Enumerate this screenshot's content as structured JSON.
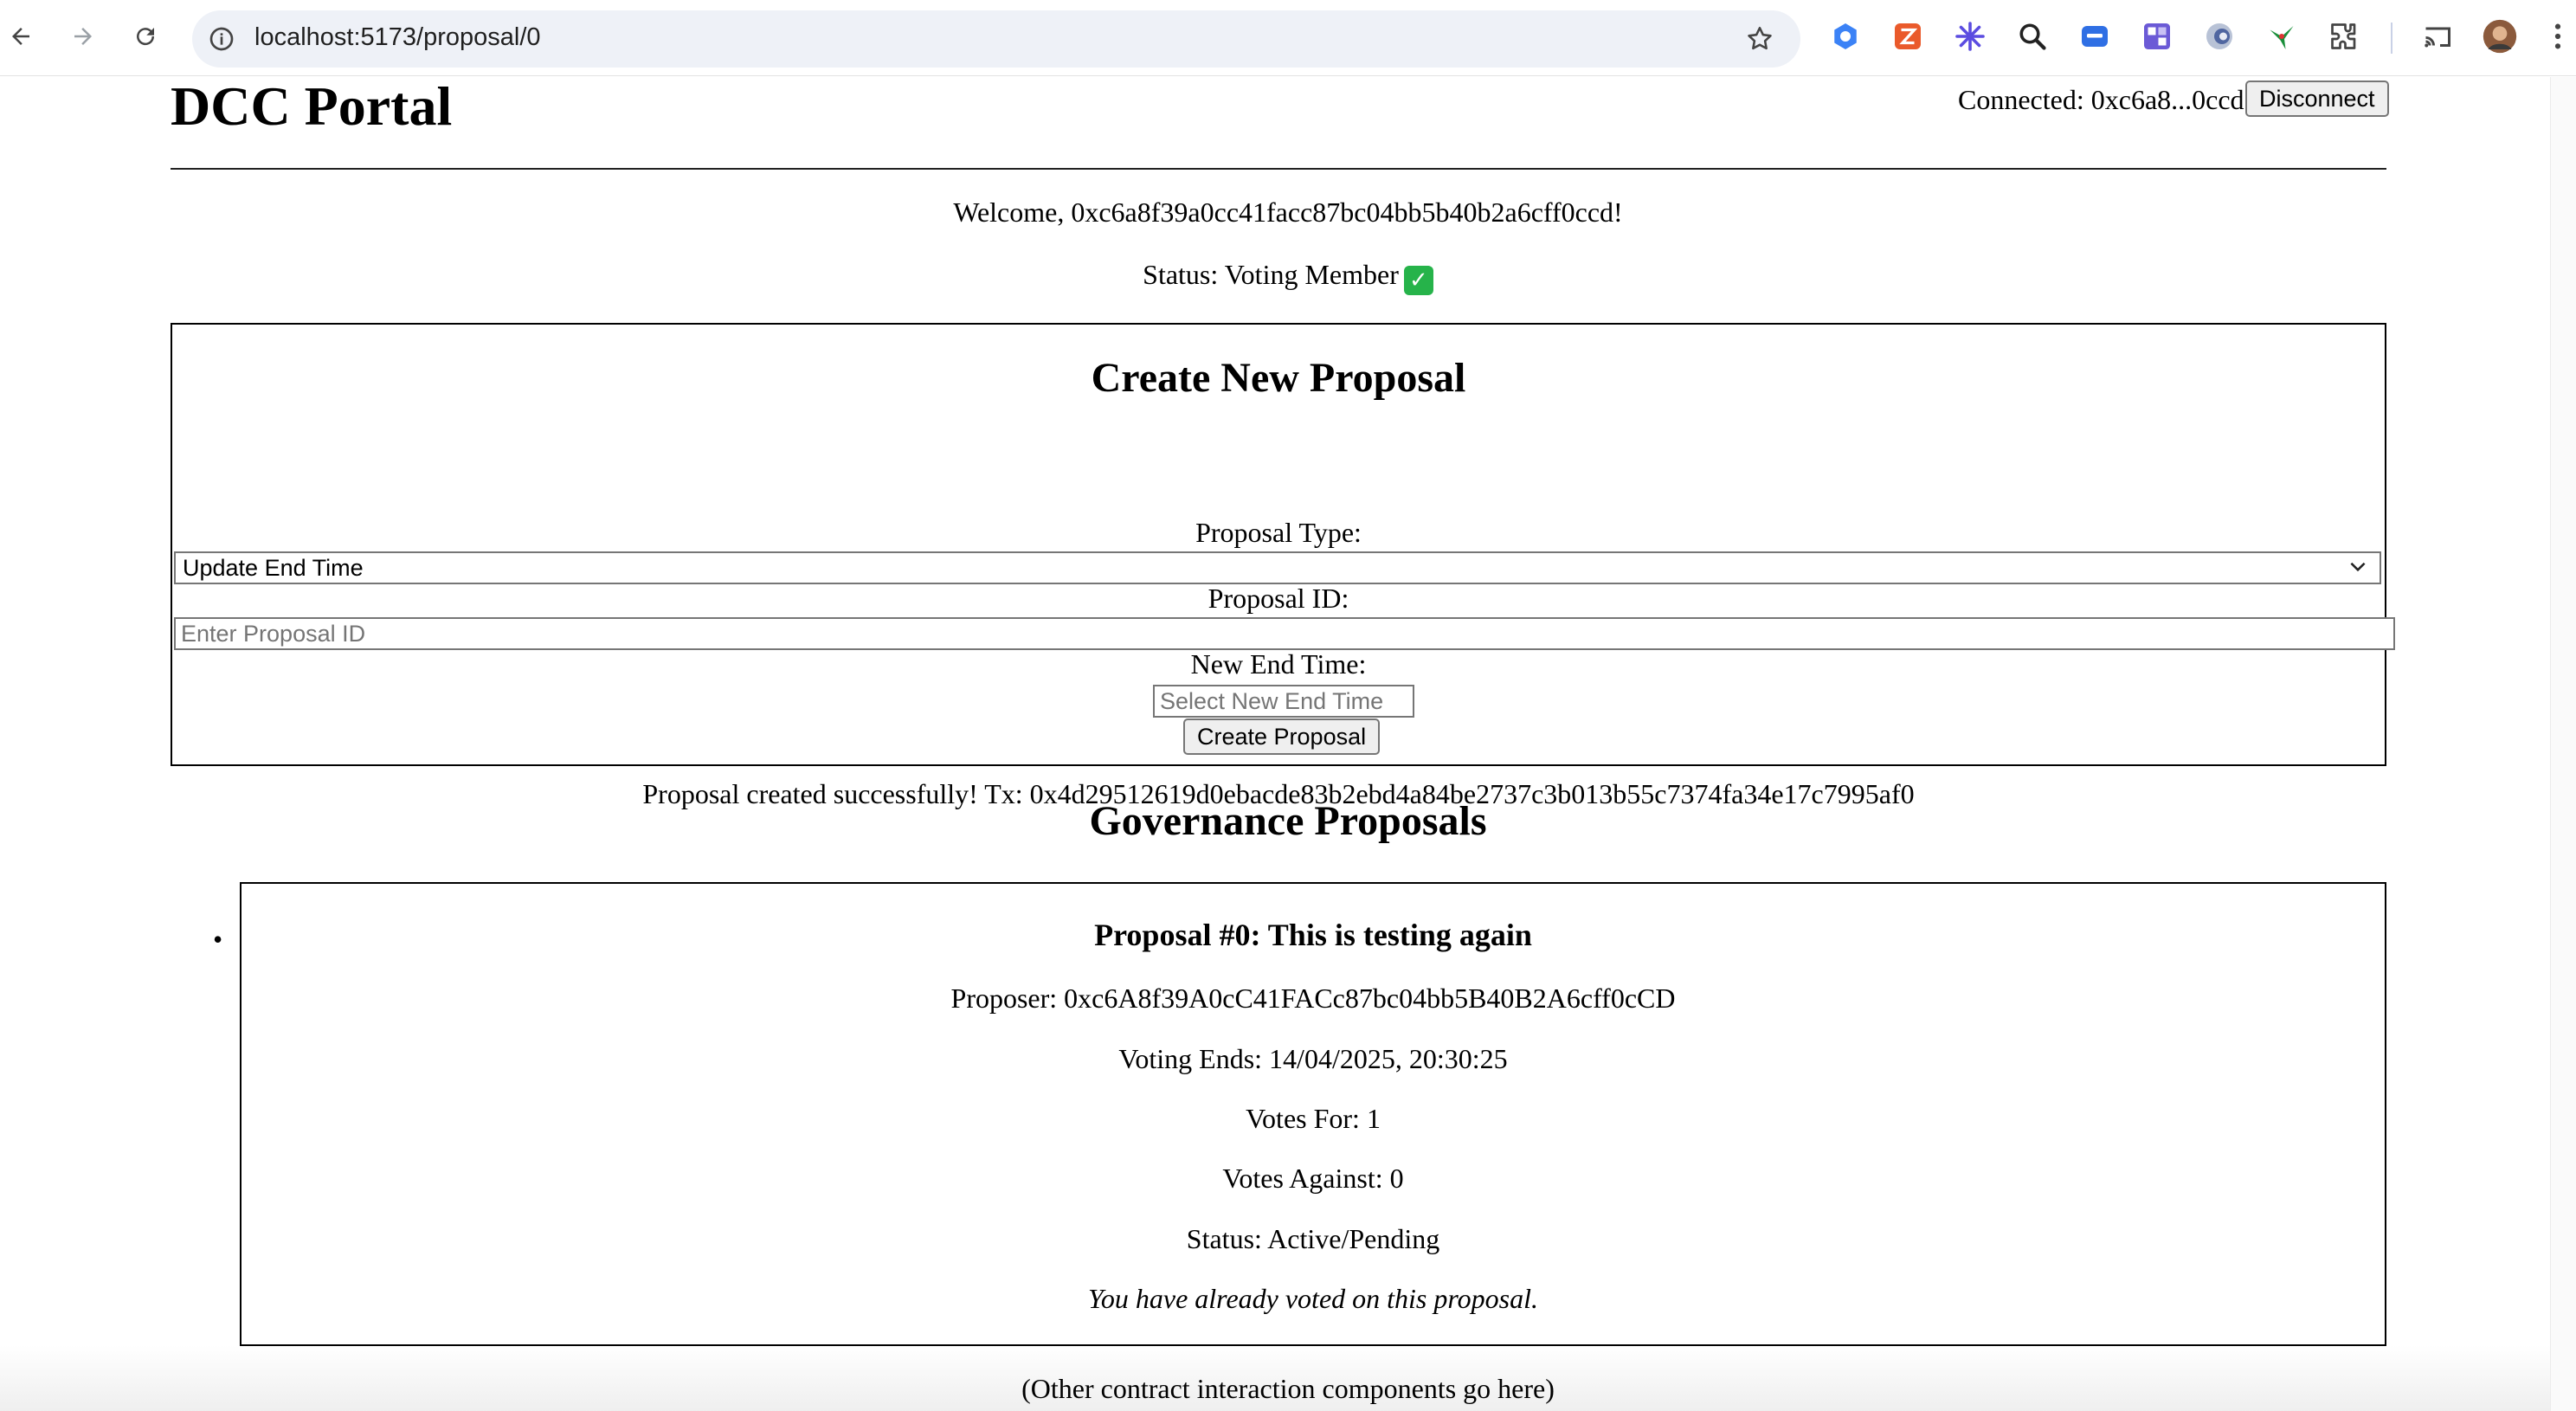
{
  "browser": {
    "url": "localhost:5173/proposal/0",
    "extensions": [
      "hubspot-icon",
      "zapier-icon",
      "sparkle-icon",
      "zoom-lens-icon",
      "translate-icon",
      "puzzle-grid-icon",
      "shield-icon",
      "bird-icon",
      "extensions-puzzle-icon",
      "cast-icon",
      "avatar"
    ]
  },
  "header": {
    "title": "DCC Portal",
    "connected": "Connected: 0xc6a8...0ccd",
    "disconnect_label": "Disconnect"
  },
  "welcome": "Welcome, 0xc6a8f39a0cc41facc87bc04bb5b40b2a6cff0ccd!",
  "status": "Status: Voting Member",
  "create": {
    "heading": "Create New Proposal",
    "type_label": "Proposal Type:",
    "type_value": "Update End Time",
    "id_label": "Proposal ID:",
    "id_placeholder": "Enter Proposal ID",
    "end_label": "New End Time:",
    "end_placeholder": "Select New End Time",
    "button_label": "Create Proposal",
    "success": "Proposal created successfully! Tx: 0x4d29512619d0ebacde83b2ebd4a84be2737c3b013b55c7374fa34e17c7995af0"
  },
  "governance": {
    "heading": "Governance Proposals",
    "proposals": [
      {
        "title": "Proposal #0: This is testing again",
        "proposer": "Proposer: 0xc6A8f39A0cC41FACc87bc04bb5B40B2A6cff0cCD",
        "voting_ends": "Voting Ends: 14/04/2025, 20:30:25",
        "votes_for": "Votes For: 1",
        "votes_against": "Votes Against: 0",
        "status": "Status: Active/Pending",
        "note": "You have already voted on this proposal."
      }
    ]
  },
  "footer_note": "(Other contract interaction components go here)"
}
